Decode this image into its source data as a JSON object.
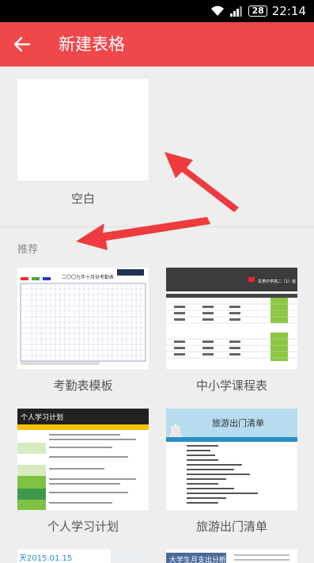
{
  "status_bar": {
    "battery": "28",
    "time": "22:14"
  },
  "app_bar": {
    "title": "新建表格"
  },
  "blank": {
    "label": "空白"
  },
  "section": {
    "title": "推荐"
  },
  "templates": [
    {
      "label": "考勤表模板",
      "preview_title": "二〇〇九年十月份考勤表"
    },
    {
      "label": "中小学课程表",
      "preview_title": "甘肃中学高二（1）班"
    },
    {
      "label": "个人学习计划",
      "preview_title": "个人学习计划"
    },
    {
      "label": "旅游出门清单",
      "preview_title": "旅游出门清单"
    }
  ],
  "partial": [
    {
      "preview_title": "天2015.01.15"
    },
    {
      "preview_title": "大学生月支出分析"
    }
  ],
  "colors": {
    "accent": "#f0474b",
    "arrow": "#ee3b3e"
  }
}
